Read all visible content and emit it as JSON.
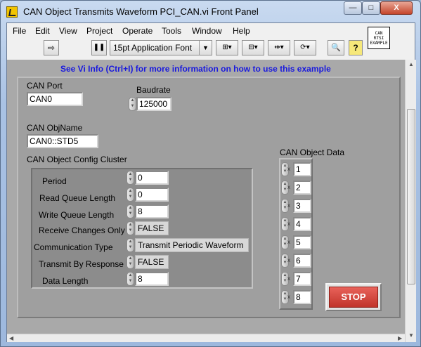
{
  "window": {
    "title": "CAN Object Transmits Waveform PCI_CAN.vi Front Panel",
    "min_glyph": "—",
    "max_glyph": "□",
    "close_glyph": "X"
  },
  "menus": [
    "File",
    "Edit",
    "View",
    "Project",
    "Operate",
    "Tools",
    "Window",
    "Help"
  ],
  "vi_icon_text": [
    "CAN",
    "RTSI",
    "EXAMPLE"
  ],
  "toolbar": {
    "font_select": "15pt Application Font",
    "run_glyph": "⇨",
    "pause_glyph": "❚❚",
    "search_glyph": "🔍",
    "help_glyph": "?"
  },
  "panel": {
    "info_text": "See Vi Info (Ctrl+I) for more information on how to use this example",
    "can_port_label": "CAN Port",
    "can_port_value": "CAN0",
    "baudrate_label": "Baudrate",
    "baudrate_value": "125000",
    "objname_label": "CAN ObjName",
    "objname_value": "CAN0::STD5",
    "cluster_label": "CAN Object Config Cluster",
    "cluster": {
      "period_label": "Period",
      "period_value": "0",
      "read_queue_label": "Read Queue Length",
      "read_queue_value": "0",
      "write_queue_label": "Write Queue Length",
      "write_queue_value": "8",
      "receive_changes_label": "Receive Changes Only",
      "receive_changes_value": "FALSE",
      "comm_type_label": "Communication Type",
      "comm_type_value": "Transmit Periodic Waveform",
      "transmit_response_label": "Transmit By Response",
      "transmit_response_value": "FALSE",
      "data_length_label": "Data Length",
      "data_length_value": "8"
    },
    "object_data_label": "CAN Object Data",
    "object_data": [
      "1",
      "2",
      "3",
      "4",
      "5",
      "6",
      "7",
      "8"
    ],
    "stop_label": "STOP"
  },
  "colors": {
    "panel_bg": "#a9a9a9",
    "info_text": "#1a1add",
    "stop_button": "#d0453c"
  }
}
